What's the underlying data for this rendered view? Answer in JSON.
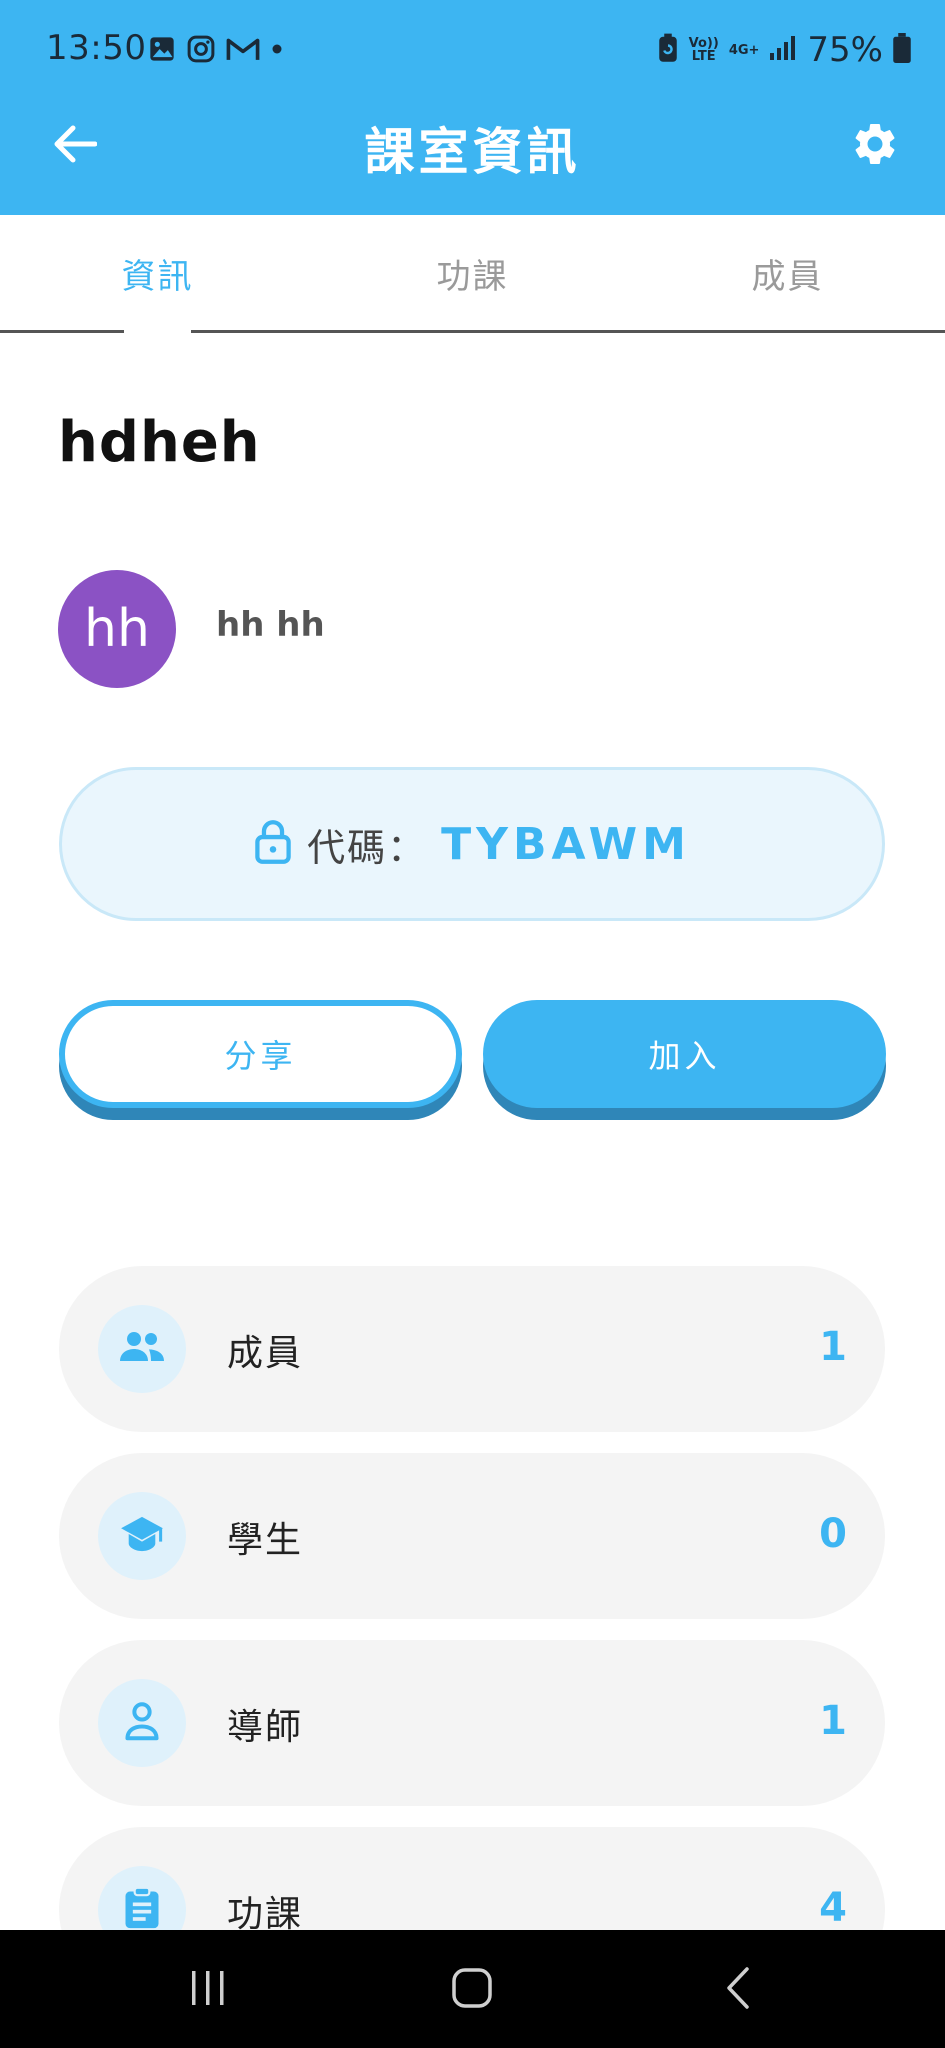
{
  "status_bar": {
    "time": "13:50",
    "battery": "75%",
    "left_icons": [
      "gallery-icon",
      "instagram-icon",
      "gmail-icon",
      "dot-icon"
    ],
    "right_icons": [
      "battery-saver-icon",
      "volte-icon",
      "4g-icon",
      "signal-icon",
      "battery-icon"
    ],
    "volte_text": "Vo)) LTE",
    "network_text": "4G+"
  },
  "app_bar": {
    "title": "課室資訊",
    "back_icon": "arrow-left-icon",
    "settings_icon": "gear-icon"
  },
  "tabs": [
    {
      "label": "資訊",
      "active": true
    },
    {
      "label": "功課",
      "active": false
    },
    {
      "label": "成員",
      "active": false
    }
  ],
  "class_info": {
    "name": "hdheh",
    "owner_initials": "hh",
    "owner_name": "hh hh",
    "code_label": "代碼：",
    "code_value": "TYBAWM"
  },
  "actions": {
    "share_label": "分享",
    "join_label": "加入"
  },
  "stats": [
    {
      "icon": "people-icon",
      "label": "成員",
      "value": "1"
    },
    {
      "icon": "graduation-cap-icon",
      "label": "學生",
      "value": "0"
    },
    {
      "icon": "person-icon",
      "label": "導師",
      "value": "1"
    },
    {
      "icon": "clipboard-icon",
      "label": "功課",
      "value": "4"
    }
  ],
  "colors": {
    "accent": "#3db5f2",
    "accent_dark": "#2f86b8",
    "avatar": "#8b52c4"
  }
}
